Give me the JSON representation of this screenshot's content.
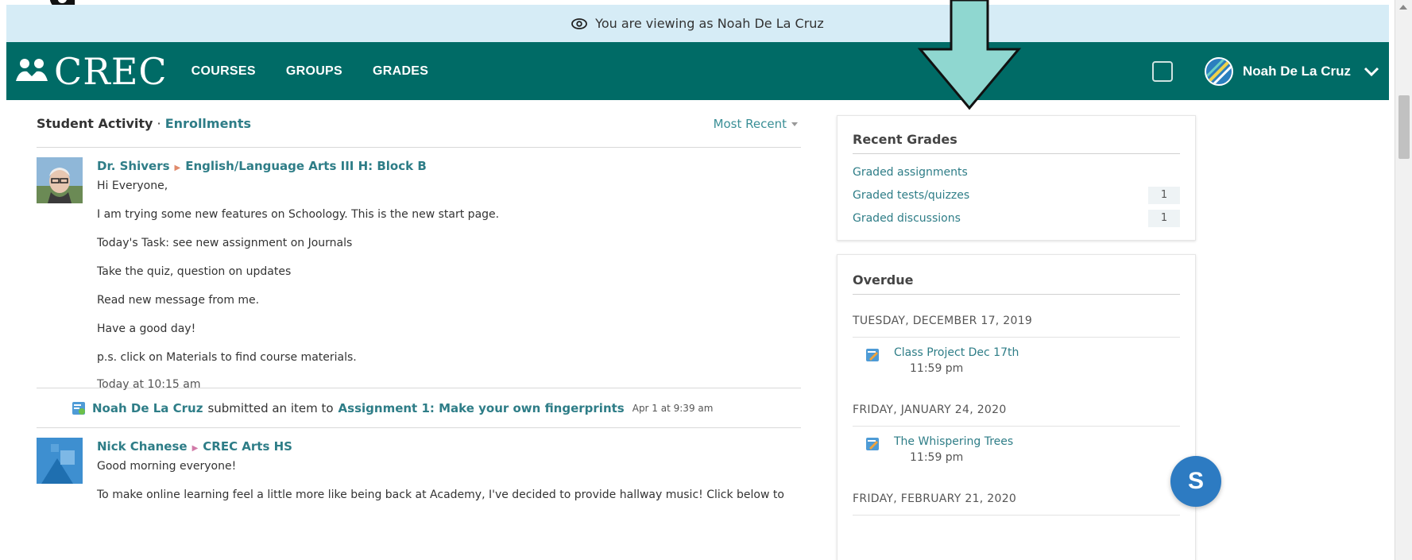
{
  "banner": {
    "text": "You are viewing as Noah De La Cruz",
    "icon": "eye-icon"
  },
  "nav": {
    "logo_text": "CREC",
    "links": [
      "COURSES",
      "GROUPS",
      "GRADES"
    ],
    "user_name": "Noah De La Cruz"
  },
  "activity": {
    "label": "Student Activity",
    "separator": " · ",
    "link": "Enrollments",
    "sort": "Most Recent"
  },
  "posts": [
    {
      "author": "Dr. Shivers",
      "course": "English/Language Arts III H: Block B",
      "lines": [
        "Hi Everyone,",
        "I am trying some new features on Schoology. This is the new start page.",
        "Today's Task: see new assignment on Journals",
        "Take the quiz, question on updates",
        "Read new message from me.",
        "Have a good day!",
        "p.s. click on Materials to find course materials."
      ],
      "time": "Today at 10:15 am"
    },
    {
      "author": "Nick Chanese",
      "course": "CREC Arts HS",
      "lines": [
        "Good morning everyone!",
        "To make online learning feel a little more like being back at Academy, I've decided to provide hallway music! Click below to"
      ]
    }
  ],
  "submission": {
    "name": "Noah De La Cruz",
    "verb": "submitted an item to",
    "assignment": "Assignment 1: Make your own fingerprints",
    "date": "Apr 1 at 9:39 am"
  },
  "recent_grades": {
    "title": "Recent Grades",
    "rows": [
      {
        "label": "Graded assignments",
        "count": ""
      },
      {
        "label": "Graded tests/quizzes",
        "count": "1"
      },
      {
        "label": "Graded discussions",
        "count": "1"
      }
    ]
  },
  "overdue": {
    "title": "Overdue",
    "groups": [
      {
        "date": "TUESDAY, DECEMBER 17, 2019",
        "item": "Class Project Dec 17th",
        "time": "11:59 pm"
      },
      {
        "date": "FRIDAY, JANUARY 24, 2020",
        "item": "The Whispering Trees",
        "time": "11:59 pm"
      },
      {
        "date": "FRIDAY, FEBRUARY 21, 2020"
      }
    ]
  },
  "chat": {
    "letter": "S"
  },
  "colors": {
    "nav": "#006b66",
    "banner": "#d6ecf6",
    "link": "#2e7d87",
    "arrow": "#8fd7d0"
  }
}
